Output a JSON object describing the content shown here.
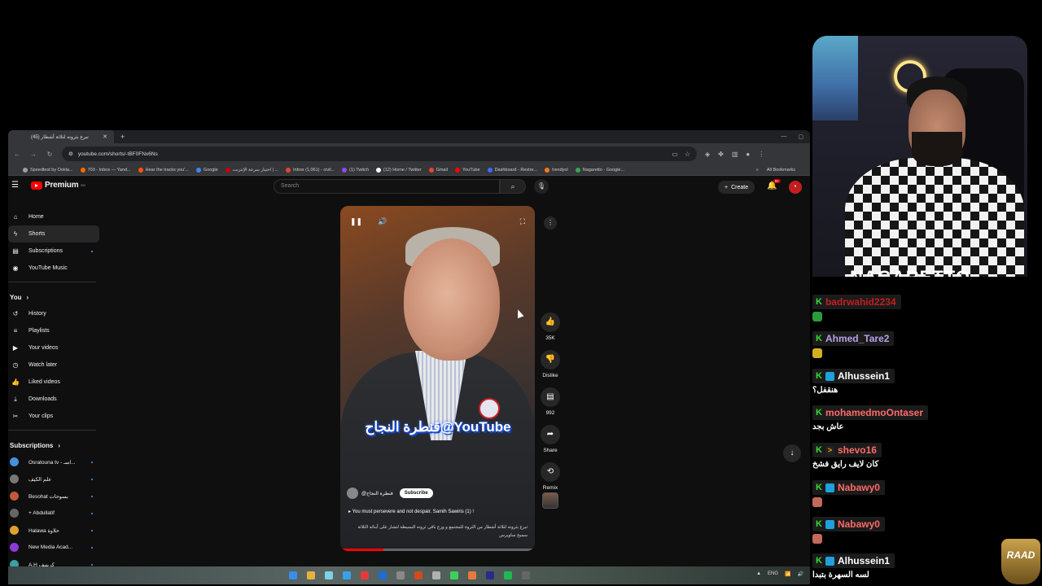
{
  "browser": {
    "tab_title": "(45) تبرع بثروته لثلاثة أشطار",
    "new_tab": "+",
    "url": "youtube.com/shorts/-tBF0FNx6Ns",
    "bookmarks": [
      {
        "label": "Speedtest by Ookla...",
        "color": "#9aa0a6"
      },
      {
        "label": "703 - Inbox — Yand...",
        "color": "#ff6a00"
      },
      {
        "label": "Hear the tracks you'...",
        "color": "#ff5500"
      },
      {
        "label": "Google",
        "color": "#4285f4"
      },
      {
        "label": "اختبار سرعة الإنترنت | ...",
        "color": "#cc0000"
      },
      {
        "label": "Inbox (1,061) - civil...",
        "color": "#ea4335"
      },
      {
        "label": "(1) Twitch",
        "color": "#9146ff"
      },
      {
        "label": "(12) Home / Twitter",
        "color": "#ffffff"
      },
      {
        "label": "Gmail",
        "color": "#ea4335"
      },
      {
        "label": "YouTube",
        "color": "#ff0000"
      },
      {
        "label": "Dashboard - Restre...",
        "color": "#3b6cff"
      },
      {
        "label": "trendyol",
        "color": "#f27a1a"
      },
      {
        "label": "Nagaretto - Google...",
        "color": "#34a853"
      }
    ],
    "all_bookmarks": "All Bookmarks"
  },
  "youtube": {
    "logo": "Premium",
    "logo_sup": "EG",
    "search_placeholder": "Search",
    "create_label": "Create",
    "notif_badge": "9+",
    "sidebar_main": [
      {
        "label": "Home",
        "icon": "⌂"
      },
      {
        "label": "Shorts",
        "icon": "ϟ"
      },
      {
        "label": "Subscriptions",
        "icon": "▤"
      },
      {
        "label": "YouTube Music",
        "icon": "◉"
      }
    ],
    "you_heading": "You",
    "sidebar_you": [
      {
        "label": "History",
        "icon": "↺"
      },
      {
        "label": "Playlists",
        "icon": "≡"
      },
      {
        "label": "Your videos",
        "icon": "▶"
      },
      {
        "label": "Watch later",
        "icon": "◷"
      },
      {
        "label": "Liked videos",
        "icon": "👍"
      },
      {
        "label": "Downloads",
        "icon": "⤓"
      },
      {
        "label": "Your clips",
        "icon": "✂"
      }
    ],
    "subscriptions_heading": "Subscriptions",
    "subscriptions": [
      {
        "label": "Osratouna tv - اسـ...",
        "color": "#4a90d9"
      },
      {
        "label": "علم الكيف",
        "color": "#777777"
      },
      {
        "label": "Besohat بسوحات",
        "color": "#c05a3a"
      },
      {
        "label": "+ Abdullatif",
        "color": "#666666"
      },
      {
        "label": "Halawa حلاوة",
        "color": "#e0a030"
      },
      {
        "label": "New Media Acad...",
        "color": "#8a3ad9"
      },
      {
        "label": "A.H كريتيف",
        "color": "#3aa0a0"
      }
    ],
    "short": {
      "watermark": "قنطرة النجاح@YouTube",
      "channel": "@قنطرة النجاح",
      "subscribe": "Subscribe",
      "song": "You must persevere and not despair. Samih Sawiris (1) !",
      "description": "تبرع بثروته لثلاثة أشطار من الثروة للمجتمع و وزع باقي ثروته البسيطة لتشار على أبنائه الثلاثة سميح ساويرس",
      "progress": 0.22
    },
    "actions": {
      "likes": "35K",
      "dislike": "Dislike",
      "comments": "992",
      "share": "Share",
      "remix": "Remix"
    }
  },
  "stream": {
    "streamer_name": "NAGARETTO",
    "chat": [
      {
        "user": "badrwahid2234",
        "color": "#c41e1e",
        "badges": [
          "k"
        ],
        "emote": "#2a9a3a"
      },
      {
        "user": "Ahmed_Tare2",
        "color": "#b8a0e8",
        "badges": [
          "k"
        ],
        "emote": "#d4b020"
      },
      {
        "user": "Alhussein1",
        "color": "#ffffff",
        "badges": [
          "k",
          "b"
        ],
        "text": "هنقفل؟"
      },
      {
        "user": "mohamedmoOntaser",
        "color": "#ff6a6a",
        "badges": [
          "k"
        ],
        "text": "عاش بجد"
      },
      {
        "user": "shevo16",
        "color": "#ff6a6a",
        "badges": [
          "k",
          "w"
        ],
        "text": "كان لايف رايق فشخ"
      },
      {
        "user": "Nabawy0",
        "color": "#ff6a6a",
        "badges": [
          "k",
          "b"
        ],
        "emote": "#c26a5a"
      },
      {
        "user": "Nabawy0",
        "color": "#ff6a6a",
        "badges": [
          "k",
          "b"
        ],
        "emote": "#c26a5a"
      },
      {
        "user": "Alhussein1",
        "color": "#ffffff",
        "badges": [
          "k",
          "b"
        ],
        "text": "لسه السهرة بتبدا"
      }
    ],
    "overlay_logo": "RAAD"
  }
}
